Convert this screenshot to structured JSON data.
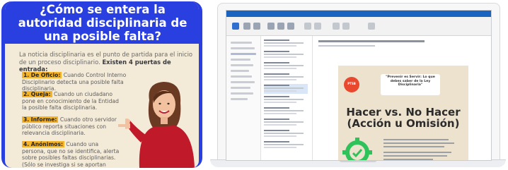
{
  "infographic": {
    "title": "¿Cómo se entera la autoridad disciplinaria de una posible falta?",
    "intro_text": "La noticia disciplinaria es el punto de partida para el inicio de un proceso disciplinario.",
    "intro_bold": "Existen 4 puertas de entrada:",
    "items": [
      {
        "num": "1. De Oficio:",
        "text": " Cuando Control Interno Disciplinario detecta una posible falta disciplinaria."
      },
      {
        "num": "2. Queja:",
        "text": " Cuando un ciudadano pone en conocimiento de la Entidad la posible falta disciplinaria."
      },
      {
        "num": "3. Informe:",
        "text": " Cuando otro servidor público reporta situaciones con relevancia disciplinaria."
      },
      {
        "num": "4. Anónimos:",
        "text": " Cuando una persona, que no se identifica, alerta sobre posibles faltas disciplinarias. (Sólo se investiga si se aportan pruebas"
      }
    ],
    "colors": {
      "frame": "#2a3fe0",
      "background": "#f4ead8",
      "highlight": "#f5b428"
    }
  },
  "laptop": {
    "poster": {
      "badge": "PTSB",
      "bubble_text": "\"Prevenir es Servir: Lo que debes saber de la Ley Disciplinaria\"",
      "headline": "Hacer vs. No Hacer (Acción u Omisión)"
    },
    "colors": {
      "titlebar": "#1a64c0",
      "poster_bg": "#ede2cd",
      "badge": "#e9482f",
      "gear": "#2fc25b"
    }
  }
}
